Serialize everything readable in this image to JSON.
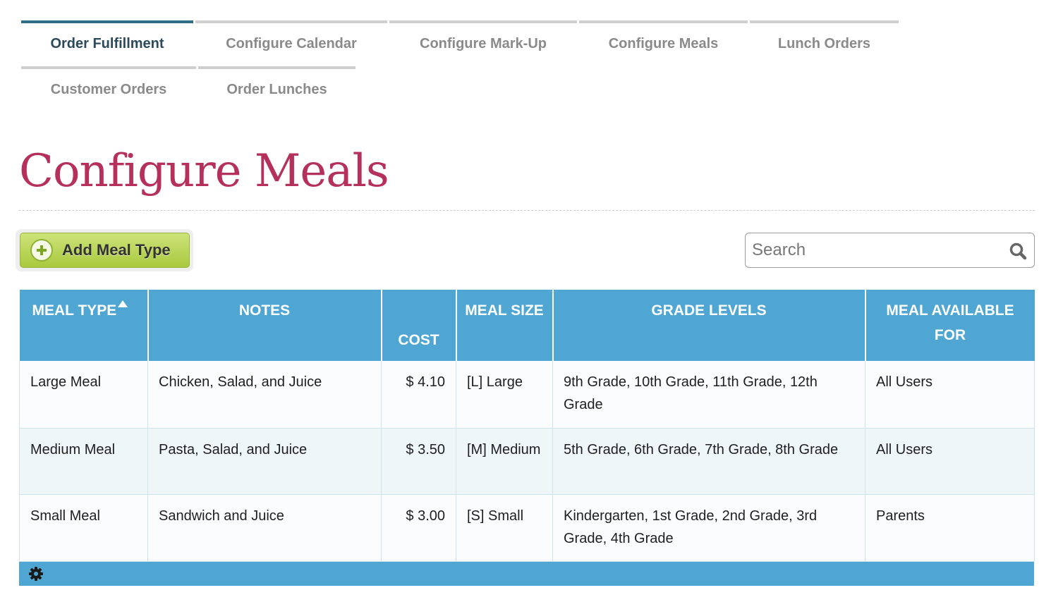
{
  "tabs": [
    {
      "label": "Order Fulfillment",
      "active": true
    },
    {
      "label": "Configure Calendar",
      "active": false
    },
    {
      "label": "Configure Mark-Up",
      "active": false
    },
    {
      "label": "Configure Meals",
      "active": false
    },
    {
      "label": "Lunch Orders",
      "active": false
    },
    {
      "label": "Customer Orders",
      "active": false
    },
    {
      "label": "Order Lunches",
      "active": false
    }
  ],
  "page": {
    "title": "Configure Meals"
  },
  "toolbar": {
    "add_label": "Add Meal Type"
  },
  "search": {
    "placeholder": "Search",
    "value": ""
  },
  "table": {
    "headers": {
      "meal_type": "MEAL TYPE",
      "notes": "NOTES",
      "cost": "COST",
      "meal_size": "MEAL SIZE",
      "grade_levels": "GRADE LEVELS",
      "available_for": "MEAL AVAILABLE FOR"
    },
    "sort": {
      "column": "meal_type",
      "direction": "ascending"
    },
    "rows": [
      {
        "meal_type": "Large Meal",
        "notes": "Chicken, Salad, and Juice",
        "cost": "$ 4.10",
        "meal_size": "[L] Large",
        "grade_levels": "9th Grade, 10th Grade, 11th Grade, 12th Grade",
        "available_for": "All Users"
      },
      {
        "meal_type": "Medium Meal",
        "notes": "Pasta, Salad, and Juice",
        "cost": "$ 3.50",
        "meal_size": "[M] Medium",
        "grade_levels": "5th Grade, 6th Grade, 7th Grade, 8th Grade",
        "available_for": "All Users"
      },
      {
        "meal_type": "Small Meal",
        "notes": "Sandwich and Juice",
        "cost": "$ 3.00",
        "meal_size": "[S] Small",
        "grade_levels": "Kindergarten, 1st Grade, 2nd Grade, 3rd Grade, 4th Grade",
        "available_for": "Parents"
      }
    ]
  },
  "icons": {
    "add": "plus-circle-icon",
    "search": "magnifier-icon",
    "sort": "sort-up-icon",
    "footer": "gear-icon"
  },
  "colors": {
    "accent_blue": "#4fa6d3",
    "title_crimson": "#b5305a",
    "active_tab": "#2f6f86",
    "button_green": "#b6d24f"
  }
}
